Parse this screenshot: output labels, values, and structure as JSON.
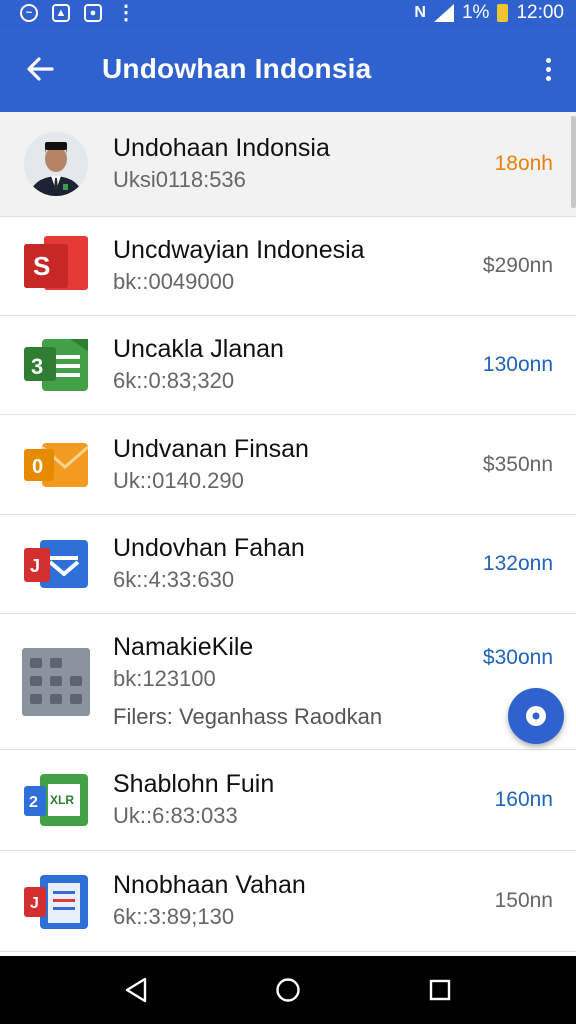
{
  "status_bar": {
    "battery": "1%",
    "time": "12:00",
    "icons": [
      "messenger-icon",
      "gallery-icon",
      "notification-icon",
      "more-dots-icon",
      "vibrate-icon",
      "signal-icon",
      "battery-icon"
    ]
  },
  "app_bar": {
    "title": "Undowhan Indonsia",
    "back_icon": "arrow-left-icon",
    "menu_icon": "more-vertical-icon"
  },
  "colors": {
    "primary": "#2f62cf",
    "amount_orange": "#e8820c",
    "amount_blue": "#1f64b8",
    "amount_gray": "#666666"
  },
  "items": [
    {
      "title": "Undohaan Indonsia",
      "subtitle": "Uksi0118:536",
      "amount": "18onh",
      "amount_color": "#e8820c",
      "icon": "profile-avatar",
      "selected": true
    },
    {
      "title": "Uncdwayian Indonesia",
      "subtitle": "bk::0049000",
      "amount": "$290nn",
      "amount_color": "#666666",
      "icon": "slides-app-icon"
    },
    {
      "title": "Uncakla Jlanan",
      "subtitle": "6k::0:83;320",
      "amount": "130onn",
      "amount_color": "#1f64b8",
      "icon": "sheets-app-icon"
    },
    {
      "title": "Undvanan Finsan",
      "subtitle": "Uk::0140.290",
      "amount": "$350nn",
      "amount_color": "#666666",
      "icon": "mail-app-icon"
    },
    {
      "title": "Undovhan Fahan",
      "subtitle": "6k::4:33:630",
      "amount": "132onn",
      "amount_color": "#1f64b8",
      "icon": "inbox-app-icon"
    },
    {
      "title": "NamakieKile",
      "subtitle": "bk:123100",
      "extra": "Filers: Veganhass Raodkan",
      "amount": "$30onn",
      "amount_color": "#1f64b8",
      "icon": "calculator-app-icon"
    },
    {
      "title": "Shablohn Fuin",
      "subtitle": "Uk::6:83:033",
      "amount": "160nn",
      "amount_color": "#1f64b8",
      "icon": "spreadsheet-app-icon"
    },
    {
      "title": "Nnobhaan Vahan",
      "subtitle": "6k::3:89;130",
      "amount": "150nn",
      "amount_color": "#666666",
      "icon": "clipboard-app-icon"
    }
  ],
  "fab_icon": "disc-icon",
  "nav_bar": {
    "icons": [
      "back-triangle-icon",
      "home-circle-icon",
      "recents-square-icon"
    ]
  }
}
